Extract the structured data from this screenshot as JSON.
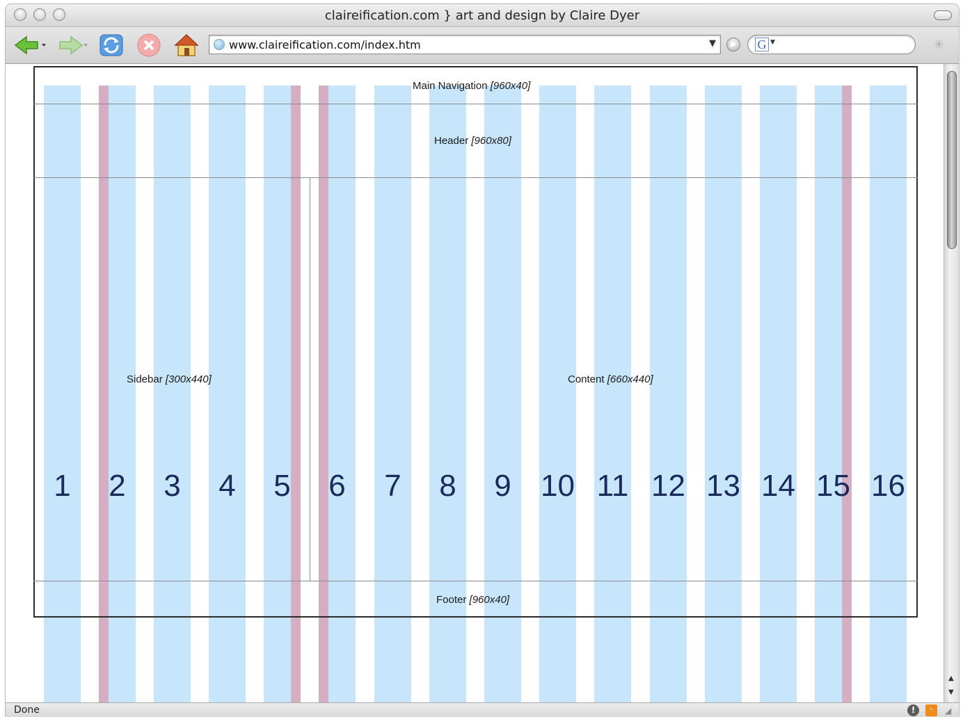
{
  "window": {
    "title": "claireification.com } art and design by Claire Dyer"
  },
  "toolbar": {
    "url": "www.claireification.com/index.htm",
    "search_placeholder": ""
  },
  "page": {
    "regions": {
      "nav_label": "Main Navigation",
      "nav_size": "[960x40]",
      "header_label": "Header",
      "header_size": "[960x80]",
      "sidebar_label": "Sidebar",
      "sidebar_size": "[300x440]",
      "content_label": "Content",
      "content_size": "[660x440]",
      "footer_label": "Footer",
      "footer_size": "[960x40]"
    },
    "columns": [
      "1",
      "2",
      "3",
      "4",
      "5",
      "6",
      "7",
      "8",
      "9",
      "10",
      "11",
      "12",
      "13",
      "14",
      "15",
      "16"
    ]
  },
  "status": {
    "text": "Done"
  },
  "colors": {
    "column_blue": "#c8e6fb",
    "column_pink": "#d4afc4",
    "column_number": "#1a2a5a"
  },
  "icons": [
    "back-arrow-icon",
    "forward-arrow-icon",
    "reload-icon",
    "stop-icon",
    "home-icon",
    "globe-icon",
    "go-icon",
    "google-icon",
    "throbber-icon",
    "info-icon",
    "rss-icon",
    "resize-grip-icon"
  ]
}
